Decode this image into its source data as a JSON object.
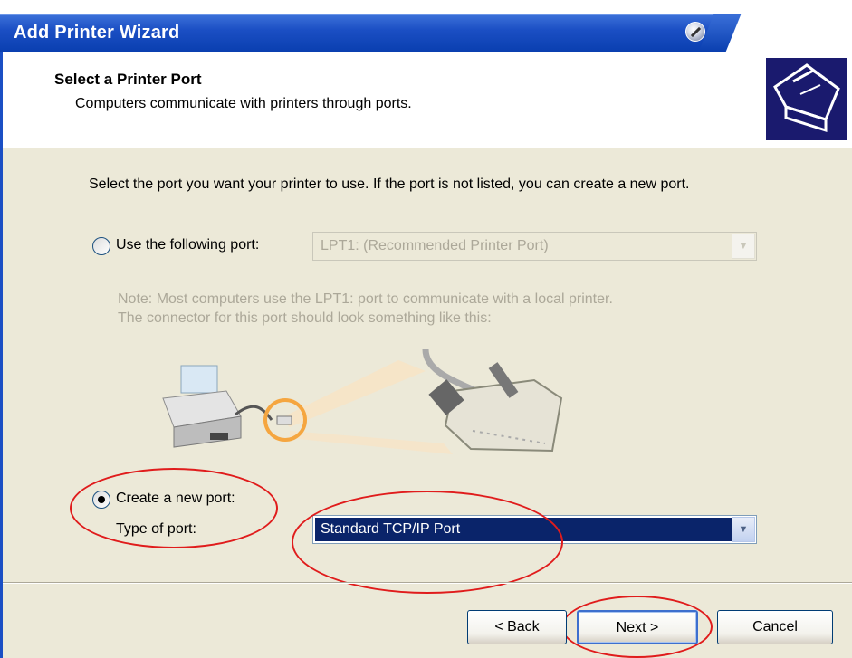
{
  "window": {
    "title": "Add Printer Wizard"
  },
  "header": {
    "title": "Select a Printer Port",
    "subtitle": "Computers communicate with printers through ports."
  },
  "body": {
    "instruction": "Select the port you want your printer to use.  If the port is not listed, you can create a new port.",
    "use_port_label": "Use the following port:",
    "use_port_value": "LPT1: (Recommended Printer Port)",
    "note_line1": "Note: Most computers use the LPT1: port to communicate with a local printer.",
    "note_line2": "The connector for this port should look something like this:",
    "create_port_label": "Create a new port:",
    "type_of_port_label": "Type of port:",
    "type_of_port_value": "Standard TCP/IP Port"
  },
  "buttons": {
    "back": "< Back",
    "next": "Next >",
    "cancel": "Cancel"
  },
  "colors": {
    "annotation": "#e01c1c",
    "titlebar": "#0a3fb0",
    "selection": "#0a246a"
  }
}
